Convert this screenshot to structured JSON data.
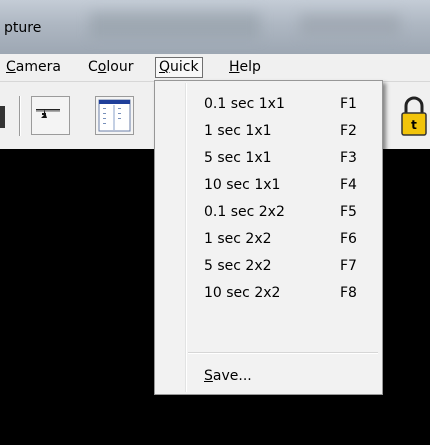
{
  "window": {
    "title": "pture"
  },
  "menubar": {
    "items": [
      {
        "label": "Camera",
        "mnemonic": "C",
        "rest": "amera"
      },
      {
        "label": "Colour",
        "pre": "C",
        "mnemonic": "o",
        "rest": "lour"
      },
      {
        "label": "Quick",
        "mnemonic": "Q",
        "rest": "uick"
      },
      {
        "label": "Help",
        "mnemonic": "H",
        "rest": "elp"
      }
    ]
  },
  "toolbar": {
    "icons": [
      "exposure-slider-icon",
      "window-layout-icon",
      "lock-icon"
    ]
  },
  "quick_menu": {
    "items": [
      {
        "label": "0.1 sec 1x1",
        "shortcut": "F1"
      },
      {
        "label": "1 sec 1x1",
        "shortcut": "F2"
      },
      {
        "label": "5 sec 1x1",
        "shortcut": "F3"
      },
      {
        "label": "10 sec 1x1",
        "shortcut": "F4"
      },
      {
        "label": "0.1 sec 2x2",
        "shortcut": "F5"
      },
      {
        "label": "1 sec 2x2",
        "shortcut": "F6"
      },
      {
        "label": "5 sec 2x2",
        "shortcut": "F7"
      },
      {
        "label": "10 sec 2x2",
        "shortcut": "F8"
      }
    ],
    "save": {
      "label": "Save...",
      "mnemonic": "S",
      "rest": "ave..."
    }
  },
  "colors": {
    "menubar_bg": "#f0f0f0",
    "menu_bg": "#f2f2f2",
    "workspace_bg": "#000000",
    "lock_body": "#f2c40a"
  }
}
